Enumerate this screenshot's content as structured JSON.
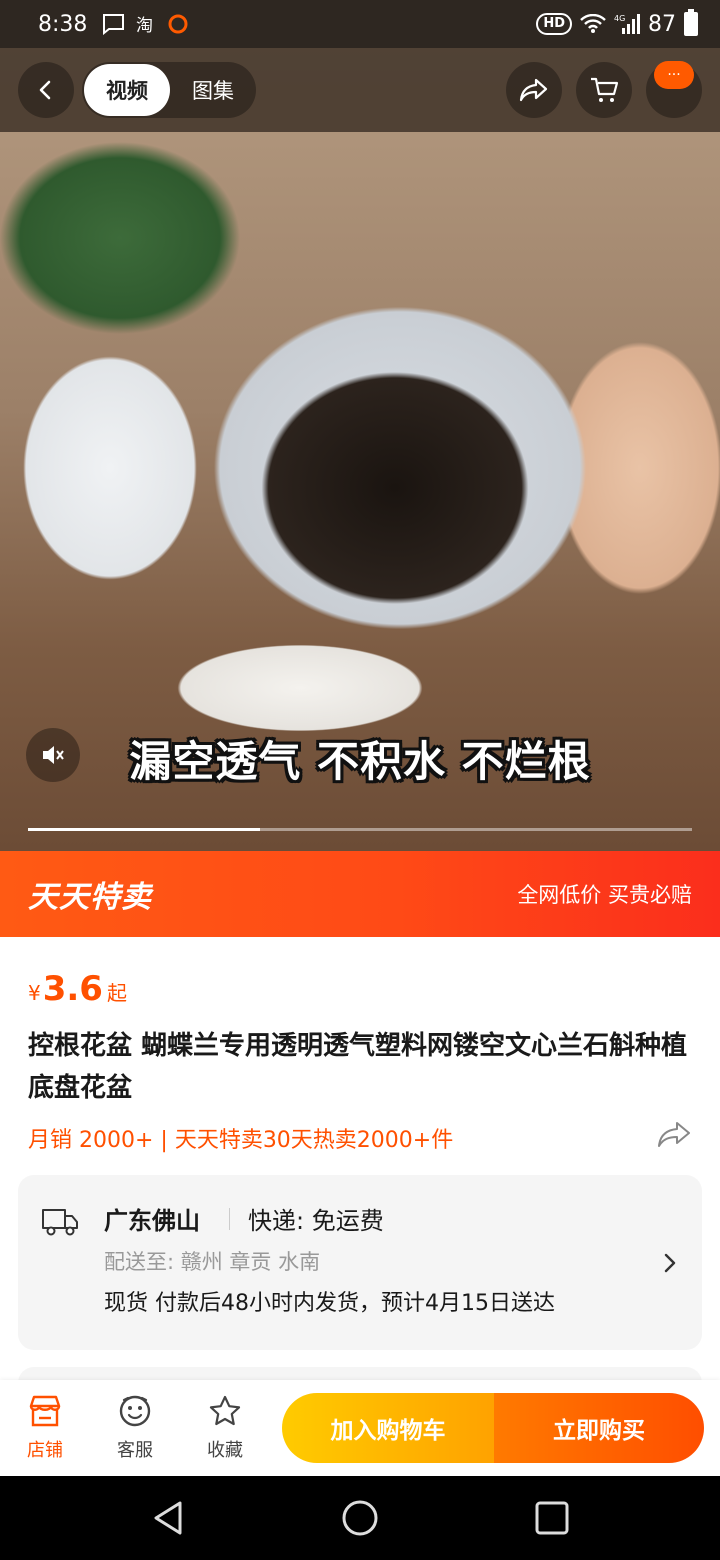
{
  "status_bar": {
    "time": "8:38",
    "hd": "HD",
    "network": "4G",
    "battery": "87"
  },
  "media": {
    "tabs": [
      {
        "label": "视频",
        "active": true
      },
      {
        "label": "图集",
        "active": false
      }
    ],
    "caption": "漏空透气 不积水 不烂根",
    "progress": 0.35,
    "more_label": "···"
  },
  "promo": {
    "title": "天天特卖",
    "slogan": "全网低价 买贵必赔"
  },
  "product": {
    "currency": "¥",
    "price": "3.6",
    "price_suffix": "起",
    "title": "控根花盆 蝴蝶兰专用透明透气塑料网镂空文心兰石斛种植底盘花盆",
    "sales": "月销 2000+ | 天天特卖30天热卖2000+件"
  },
  "shipping": {
    "origin": "广东佛山",
    "method": "快递: 免运费",
    "destination": "配送至: 赣州 章贡 水南",
    "eta": "现货 付款后48小时内发货，预计4月15日送达"
  },
  "action_bar": {
    "store_label": "店铺",
    "service_label": "客服",
    "favorite_label": "收藏",
    "add_cart_label": "加入购物车",
    "buy_now_label": "立即购买"
  },
  "colors": {
    "accent": "#ff5000",
    "promo": "#ff4a16",
    "cart_button": "#ffb300",
    "buy_button": "#ff6200"
  },
  "icons": [
    "back-icon",
    "share-icon",
    "cart-icon",
    "more-icon",
    "mute-icon",
    "truck-icon",
    "chevron-right-icon",
    "store-icon",
    "service-icon",
    "star-icon"
  ]
}
